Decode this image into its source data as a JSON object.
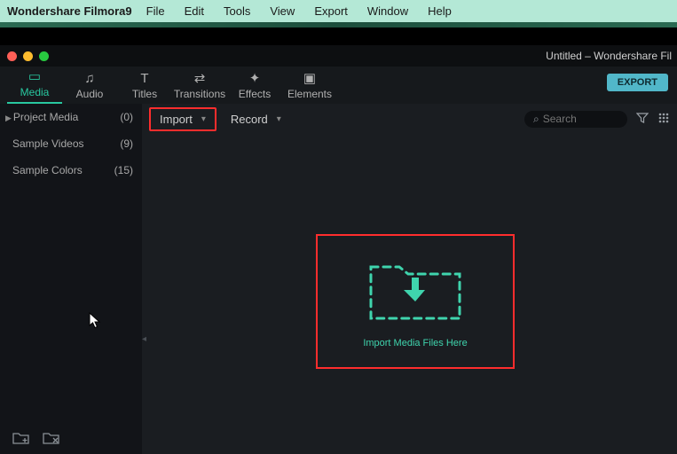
{
  "menubar": {
    "app": "Wondershare Filmora9",
    "items": [
      "File",
      "Edit",
      "Tools",
      "View",
      "Export",
      "Window",
      "Help"
    ]
  },
  "titlebar": {
    "title": "Untitled – Wondershare Fil"
  },
  "tabs": {
    "items": [
      {
        "label": "Media",
        "icon": "▭"
      },
      {
        "label": "Audio",
        "icon": "♫"
      },
      {
        "label": "Titles",
        "icon": "T"
      },
      {
        "label": "Transitions",
        "icon": "⇄"
      },
      {
        "label": "Effects",
        "icon": "✦"
      },
      {
        "label": "Elements",
        "icon": "▣"
      }
    ],
    "active_index": 0,
    "export_label": "EXPORT"
  },
  "content_bar": {
    "import_label": "Import",
    "record_label": "Record",
    "search_placeholder": "Search"
  },
  "sidebar": {
    "items": [
      {
        "label": "Project Media",
        "count": "(0)"
      },
      {
        "label": "Sample Videos",
        "count": "(9)"
      },
      {
        "label": "Sample Colors",
        "count": "(15)"
      }
    ]
  },
  "dropzone": {
    "label": "Import Media Files Here"
  },
  "colors": {
    "accent": "#28c8a0",
    "highlight": "#ff2d2d"
  }
}
